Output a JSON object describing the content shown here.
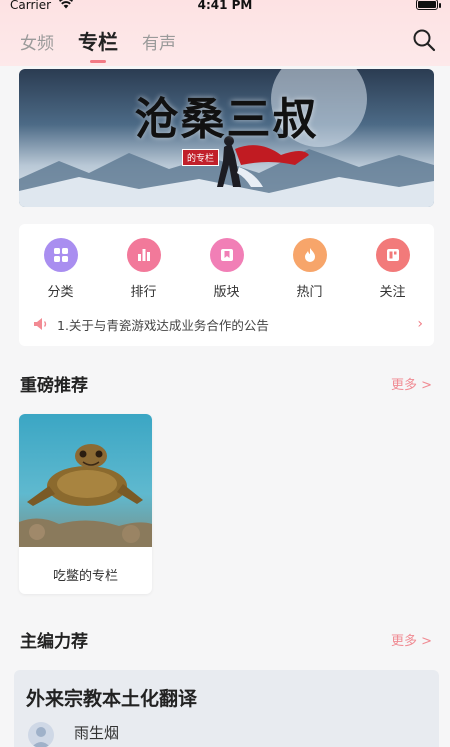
{
  "status_bar": {
    "carrier": "Carrier",
    "time": "4:41 PM"
  },
  "header": {
    "tabs": [
      {
        "label": "女频",
        "active": false
      },
      {
        "label": "专栏",
        "active": true
      },
      {
        "label": "有声",
        "active": false
      }
    ],
    "search_icon": "search-icon",
    "accent_color": "#f27a85",
    "background_color": "#fde2e3"
  },
  "banner": {
    "title": "沧桑三叔",
    "tag": "的专栏"
  },
  "quick_entries": [
    {
      "label": "分类",
      "icon": "grid-icon",
      "color": "#a98ef0"
    },
    {
      "label": "排行",
      "icon": "bar-chart-icon",
      "color": "#f2799a"
    },
    {
      "label": "版块",
      "icon": "bookmark-icon",
      "color": "#f17fb6"
    },
    {
      "label": "热门",
      "icon": "flame-icon",
      "color": "#f7a56a"
    },
    {
      "label": "关注",
      "icon": "layout-icon",
      "color": "#f27a7a"
    }
  ],
  "notice": {
    "icon": "speaker-icon",
    "text": "1.关于与青瓷游戏达成业务合作的公告"
  },
  "sections": {
    "recommended": {
      "title": "重磅推荐",
      "more": "更多 >",
      "items": [
        {
          "name": "吃鳖的专栏",
          "image": "turtle-photo"
        }
      ]
    },
    "editor_pick": {
      "title": "主编力荐",
      "more": "更多 >",
      "items": [
        {
          "title": "外来宗教本土化翻译",
          "author": "雨生烟"
        }
      ]
    }
  }
}
